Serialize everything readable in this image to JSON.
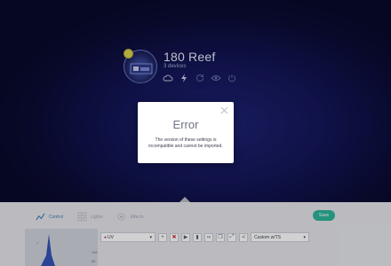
{
  "device": {
    "name": "180 Reef",
    "device_count": "3 devices",
    "status_icons": [
      "cloud-icon",
      "bolt-icon",
      "refresh-icon",
      "eye-icon",
      "power-icon"
    ]
  },
  "modal": {
    "title": "Error",
    "message": "The version of these settings is incompatible and cannot be imported."
  },
  "tabs": [
    {
      "label": "Control",
      "icon": "line-chart-icon",
      "active": true
    },
    {
      "label": "Lights",
      "icon": "grid-icon",
      "active": false
    },
    {
      "label": "Effects",
      "icon": "effects-icon",
      "active": false
    }
  ],
  "apply_label": "Save",
  "toolbar": {
    "channel_value": "UV",
    "preset_value": "Custom w/TS"
  },
  "chart": {
    "y_labels": [
      "100",
      "80"
    ]
  },
  "colors": {
    "accent": "#2fb39a",
    "hero_bg": "#171a6a",
    "tab_active": "#3b7fb8"
  }
}
